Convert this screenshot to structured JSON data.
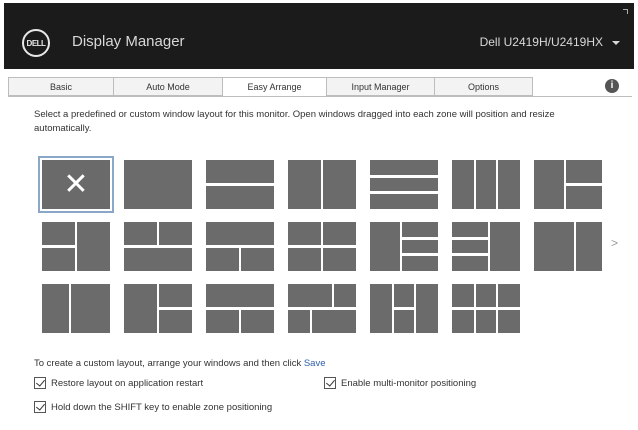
{
  "window": {
    "logo_text": "DELL",
    "app_title": "Display Manager",
    "monitor_name": "Dell U2419H/U2419HX"
  },
  "tabs": [
    {
      "label": "Basic"
    },
    {
      "label": "Auto Mode"
    },
    {
      "label": "Easy Arrange"
    },
    {
      "label": "Input Manager"
    },
    {
      "label": "Options"
    }
  ],
  "active_tab": "Easy Arrange",
  "info_glyph": "i",
  "description": "Select a predefined or custom window layout for this monitor. Open windows dragged into each zone will position and resize automatically.",
  "layouts": {
    "selected_glyph": "✕",
    "count": 20,
    "next_glyph": ">"
  },
  "custom_text": "To create a custom layout, arrange your windows and then click",
  "custom_link": "Save",
  "options": {
    "restore_label": "Restore layout on application restart",
    "restore_checked": true,
    "multi_label": "Enable multi-monitor positioning",
    "multi_checked": true,
    "shift_label": "Hold down the SHIFT key to enable zone positioning",
    "shift_checked": true
  },
  "colors": {
    "titlebar": "#1b1b1b",
    "tile": "#6b6b6b",
    "selection": "#8aa7c8",
    "link": "#2f5fa8"
  }
}
